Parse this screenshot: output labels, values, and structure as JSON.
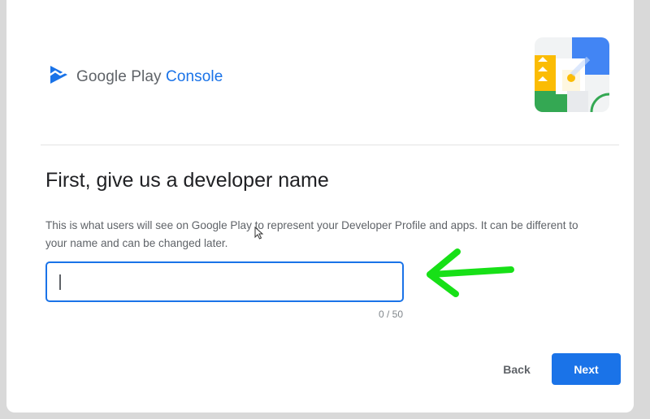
{
  "header": {
    "brand_prefix": "Google Play ",
    "brand_accent": "Console",
    "logo_icon": "play-console-logo-icon",
    "illustration_icon": "play-console-illustration"
  },
  "form": {
    "title": "First, give us a developer name",
    "description": "This is what users will see on Google Play to represent your Developer Profile and apps. It can be different to your name and can be changed later.",
    "input_value": "",
    "counter": "0 / 50"
  },
  "actions": {
    "back_label": "Back",
    "next_label": "Next"
  },
  "annotation": {
    "icon": "green-arrow-left-icon"
  },
  "colors": {
    "accent": "#1a73e8",
    "annotation": "#17e017"
  }
}
